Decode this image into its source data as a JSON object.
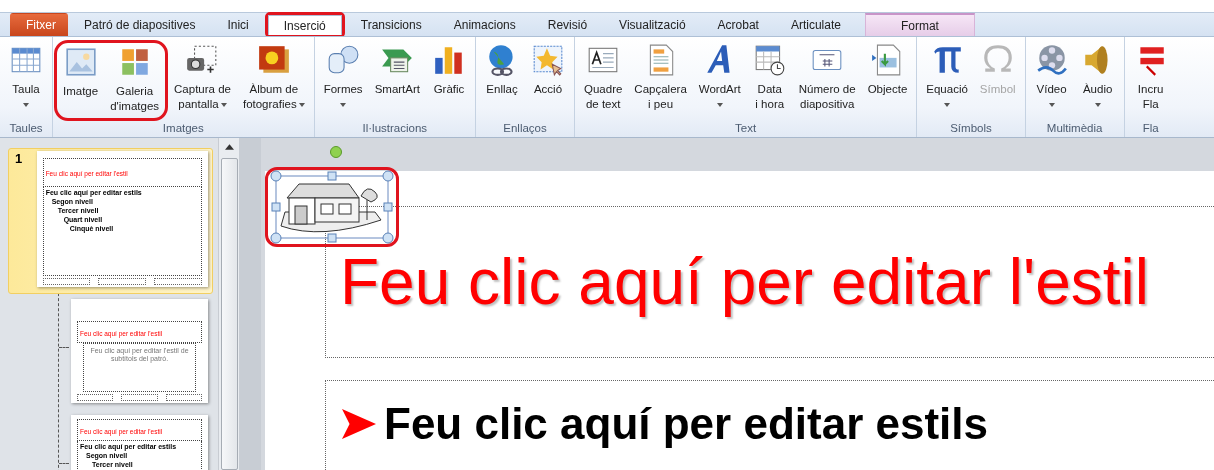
{
  "tabs": [
    {
      "label": "Fitxer",
      "kind": "file",
      "selected": false,
      "highlighted": false
    },
    {
      "label": "Patró de diapositives",
      "kind": "normal",
      "selected": false,
      "highlighted": false
    },
    {
      "label": "Inici",
      "kind": "normal",
      "selected": false,
      "highlighted": false
    },
    {
      "label": "Inserció",
      "kind": "normal",
      "selected": true,
      "highlighted": true
    },
    {
      "label": "Transicions",
      "kind": "normal",
      "selected": false,
      "highlighted": false
    },
    {
      "label": "Animacions",
      "kind": "normal",
      "selected": false,
      "highlighted": false
    },
    {
      "label": "Revisió",
      "kind": "normal",
      "selected": false,
      "highlighted": false
    },
    {
      "label": "Visualització",
      "kind": "normal",
      "selected": false,
      "highlighted": false
    },
    {
      "label": "Acrobat",
      "kind": "normal",
      "selected": false,
      "highlighted": false
    },
    {
      "label": "Articulate",
      "kind": "normal",
      "selected": false,
      "highlighted": false
    },
    {
      "label": "Format",
      "kind": "contextual",
      "selected": false,
      "highlighted": false
    }
  ],
  "ribbon": {
    "groups": [
      {
        "label": "Taules",
        "buttons": [
          {
            "lines": [
              "Taula"
            ],
            "dropdown": true,
            "disabled": false,
            "highlighted": false
          }
        ]
      },
      {
        "label": "Imatges",
        "buttons": [
          {
            "lines": [
              "Imatge"
            ],
            "dropdown": false,
            "disabled": false,
            "highlighted": true
          },
          {
            "lines": [
              "Galeria",
              "d'imatges"
            ],
            "dropdown": false,
            "disabled": false,
            "highlighted": true
          },
          {
            "lines": [
              "Captura de",
              "pantalla"
            ],
            "dropdown": true,
            "disabled": false,
            "highlighted": false
          },
          {
            "lines": [
              "Àlbum de",
              "fotografies"
            ],
            "dropdown": true,
            "disabled": false,
            "highlighted": false
          }
        ]
      },
      {
        "label": "Il·lustracions",
        "buttons": [
          {
            "lines": [
              "Formes"
            ],
            "dropdown": true,
            "disabled": false,
            "highlighted": false
          },
          {
            "lines": [
              "SmartArt"
            ],
            "dropdown": false,
            "disabled": false,
            "highlighted": false
          },
          {
            "lines": [
              "Gràfic"
            ],
            "dropdown": false,
            "disabled": false,
            "highlighted": false
          }
        ]
      },
      {
        "label": "Enllaços",
        "buttons": [
          {
            "lines": [
              "Enllaç"
            ],
            "dropdown": false,
            "disabled": false,
            "highlighted": false
          },
          {
            "lines": [
              "Acció"
            ],
            "dropdown": false,
            "disabled": false,
            "highlighted": false
          }
        ]
      },
      {
        "label": "Text",
        "buttons": [
          {
            "lines": [
              "Quadre",
              "de text"
            ],
            "dropdown": false,
            "disabled": false,
            "highlighted": false
          },
          {
            "lines": [
              "Capçalera",
              "i peu"
            ],
            "dropdown": false,
            "disabled": false,
            "highlighted": false
          },
          {
            "lines": [
              "WordArt"
            ],
            "dropdown": true,
            "disabled": false,
            "highlighted": false
          },
          {
            "lines": [
              "Data",
              "i hora"
            ],
            "dropdown": false,
            "disabled": false,
            "highlighted": false
          },
          {
            "lines": [
              "Número de",
              "diapositiva"
            ],
            "dropdown": false,
            "disabled": false,
            "highlighted": false
          },
          {
            "lines": [
              "Objecte"
            ],
            "dropdown": false,
            "disabled": false,
            "highlighted": false
          }
        ]
      },
      {
        "label": "Símbols",
        "buttons": [
          {
            "lines": [
              "Equació"
            ],
            "dropdown": true,
            "disabled": false,
            "highlighted": false
          },
          {
            "lines": [
              "Símbol"
            ],
            "dropdown": false,
            "disabled": true,
            "highlighted": false
          }
        ]
      },
      {
        "label": "Multimèdia",
        "buttons": [
          {
            "lines": [
              "Vídeo"
            ],
            "dropdown": true,
            "disabled": false,
            "highlighted": false
          },
          {
            "lines": [
              "Àudio"
            ],
            "dropdown": true,
            "disabled": false,
            "highlighted": false
          }
        ]
      },
      {
        "label": "Fla",
        "buttons": [
          {
            "lines": [
              "Incru",
              "Fla"
            ],
            "dropdown": false,
            "disabled": false,
            "highlighted": false
          }
        ]
      }
    ]
  },
  "slide_pane": {
    "thumbnails": [
      {
        "number": "1",
        "selected": true,
        "kind": "content",
        "title": "Feu clic aquí per editar l'estil",
        "bullets": [
          {
            "text": "Feu clic aquí per editar estils",
            "children": [
              {
                "text": "Segon nivell",
                "children": [
                  {
                    "text": "Tercer nivell",
                    "children": [
                      {
                        "text": "Quart nivell",
                        "children": [
                          {
                            "text": "Cinquè nivell"
                          }
                        ]
                      }
                    ]
                  }
                ]
              }
            ]
          }
        ]
      },
      {
        "selected": false,
        "kind": "title",
        "title": "Feu clic aquí per editar l'estil",
        "subtitle": "Feu clic aquí per editar l'estil de subtítols del patró."
      },
      {
        "selected": false,
        "kind": "content",
        "title": "Feu clic aquí per editar l'estil",
        "bullets": [
          {
            "text": "Feu clic aquí per editar estils",
            "children": [
              {
                "text": "Segon nivell",
                "children": [
                  {
                    "text": "Tercer nivell"
                  }
                ]
              }
            ]
          }
        ]
      }
    ]
  },
  "slide": {
    "title": "Feu clic aquí per editar l'estil",
    "bullet": "Feu clic aquí per editar estils",
    "picture": {
      "selected": true,
      "highlighted": true
    }
  }
}
